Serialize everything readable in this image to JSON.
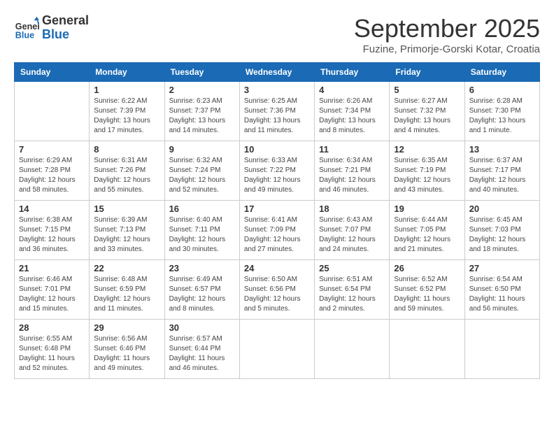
{
  "header": {
    "logo_general": "General",
    "logo_blue": "Blue",
    "month_title": "September 2025",
    "subtitle": "Fuzine, Primorje-Gorski Kotar, Croatia"
  },
  "weekdays": [
    "Sunday",
    "Monday",
    "Tuesday",
    "Wednesday",
    "Thursday",
    "Friday",
    "Saturday"
  ],
  "weeks": [
    [
      {
        "day": "",
        "info": ""
      },
      {
        "day": "1",
        "info": "Sunrise: 6:22 AM\nSunset: 7:39 PM\nDaylight: 13 hours\nand 17 minutes."
      },
      {
        "day": "2",
        "info": "Sunrise: 6:23 AM\nSunset: 7:37 PM\nDaylight: 13 hours\nand 14 minutes."
      },
      {
        "day": "3",
        "info": "Sunrise: 6:25 AM\nSunset: 7:36 PM\nDaylight: 13 hours\nand 11 minutes."
      },
      {
        "day": "4",
        "info": "Sunrise: 6:26 AM\nSunset: 7:34 PM\nDaylight: 13 hours\nand 8 minutes."
      },
      {
        "day": "5",
        "info": "Sunrise: 6:27 AM\nSunset: 7:32 PM\nDaylight: 13 hours\nand 4 minutes."
      },
      {
        "day": "6",
        "info": "Sunrise: 6:28 AM\nSunset: 7:30 PM\nDaylight: 13 hours\nand 1 minute."
      }
    ],
    [
      {
        "day": "7",
        "info": "Sunrise: 6:29 AM\nSunset: 7:28 PM\nDaylight: 12 hours\nand 58 minutes."
      },
      {
        "day": "8",
        "info": "Sunrise: 6:31 AM\nSunset: 7:26 PM\nDaylight: 12 hours\nand 55 minutes."
      },
      {
        "day": "9",
        "info": "Sunrise: 6:32 AM\nSunset: 7:24 PM\nDaylight: 12 hours\nand 52 minutes."
      },
      {
        "day": "10",
        "info": "Sunrise: 6:33 AM\nSunset: 7:22 PM\nDaylight: 12 hours\nand 49 minutes."
      },
      {
        "day": "11",
        "info": "Sunrise: 6:34 AM\nSunset: 7:21 PM\nDaylight: 12 hours\nand 46 minutes."
      },
      {
        "day": "12",
        "info": "Sunrise: 6:35 AM\nSunset: 7:19 PM\nDaylight: 12 hours\nand 43 minutes."
      },
      {
        "day": "13",
        "info": "Sunrise: 6:37 AM\nSunset: 7:17 PM\nDaylight: 12 hours\nand 40 minutes."
      }
    ],
    [
      {
        "day": "14",
        "info": "Sunrise: 6:38 AM\nSunset: 7:15 PM\nDaylight: 12 hours\nand 36 minutes."
      },
      {
        "day": "15",
        "info": "Sunrise: 6:39 AM\nSunset: 7:13 PM\nDaylight: 12 hours\nand 33 minutes."
      },
      {
        "day": "16",
        "info": "Sunrise: 6:40 AM\nSunset: 7:11 PM\nDaylight: 12 hours\nand 30 minutes."
      },
      {
        "day": "17",
        "info": "Sunrise: 6:41 AM\nSunset: 7:09 PM\nDaylight: 12 hours\nand 27 minutes."
      },
      {
        "day": "18",
        "info": "Sunrise: 6:43 AM\nSunset: 7:07 PM\nDaylight: 12 hours\nand 24 minutes."
      },
      {
        "day": "19",
        "info": "Sunrise: 6:44 AM\nSunset: 7:05 PM\nDaylight: 12 hours\nand 21 minutes."
      },
      {
        "day": "20",
        "info": "Sunrise: 6:45 AM\nSunset: 7:03 PM\nDaylight: 12 hours\nand 18 minutes."
      }
    ],
    [
      {
        "day": "21",
        "info": "Sunrise: 6:46 AM\nSunset: 7:01 PM\nDaylight: 12 hours\nand 15 minutes."
      },
      {
        "day": "22",
        "info": "Sunrise: 6:48 AM\nSunset: 6:59 PM\nDaylight: 12 hours\nand 11 minutes."
      },
      {
        "day": "23",
        "info": "Sunrise: 6:49 AM\nSunset: 6:57 PM\nDaylight: 12 hours\nand 8 minutes."
      },
      {
        "day": "24",
        "info": "Sunrise: 6:50 AM\nSunset: 6:56 PM\nDaylight: 12 hours\nand 5 minutes."
      },
      {
        "day": "25",
        "info": "Sunrise: 6:51 AM\nSunset: 6:54 PM\nDaylight: 12 hours\nand 2 minutes."
      },
      {
        "day": "26",
        "info": "Sunrise: 6:52 AM\nSunset: 6:52 PM\nDaylight: 11 hours\nand 59 minutes."
      },
      {
        "day": "27",
        "info": "Sunrise: 6:54 AM\nSunset: 6:50 PM\nDaylight: 11 hours\nand 56 minutes."
      }
    ],
    [
      {
        "day": "28",
        "info": "Sunrise: 6:55 AM\nSunset: 6:48 PM\nDaylight: 11 hours\nand 52 minutes."
      },
      {
        "day": "29",
        "info": "Sunrise: 6:56 AM\nSunset: 6:46 PM\nDaylight: 11 hours\nand 49 minutes."
      },
      {
        "day": "30",
        "info": "Sunrise: 6:57 AM\nSunset: 6:44 PM\nDaylight: 11 hours\nand 46 minutes."
      },
      {
        "day": "",
        "info": ""
      },
      {
        "day": "",
        "info": ""
      },
      {
        "day": "",
        "info": ""
      },
      {
        "day": "",
        "info": ""
      }
    ]
  ]
}
